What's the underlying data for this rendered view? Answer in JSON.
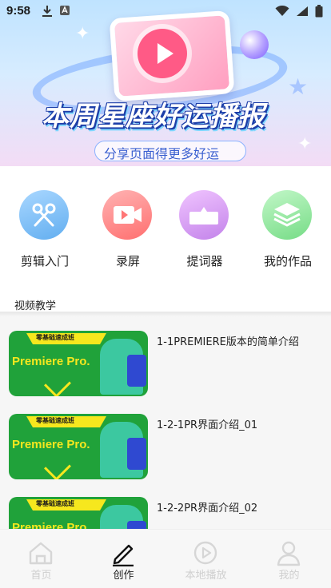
{
  "status_bar": {
    "time": "9:58"
  },
  "banner": {
    "title": "本周星座好运播报",
    "subtitle": "分享页面得更多好运"
  },
  "actions": [
    {
      "label": "剪辑入门",
      "icon": "scissors-icon",
      "color": "#79bff5"
    },
    {
      "label": "录屏",
      "icon": "video-camera-icon",
      "color": "#ff8686"
    },
    {
      "label": "提词器",
      "icon": "teleprompter-icon",
      "color": "#d79af0"
    },
    {
      "label": "我的作品",
      "icon": "layers-icon",
      "color": "#8ee79a"
    }
  ],
  "section": {
    "title": "视频教学"
  },
  "videos": [
    {
      "title": "1-1PREMIERE版本的简单介绍",
      "thumb_top": "零基础速成班",
      "thumb_main": "Premiere Pro."
    },
    {
      "title": "1-2-1PR界面介绍_01",
      "thumb_top": "零基础速成班",
      "thumb_main": "Premiere Pro."
    },
    {
      "title": "1-2-2PR界面介绍_02",
      "thumb_top": "零基础速成班",
      "thumb_main": "Premiere Pro."
    }
  ],
  "tabs": [
    {
      "label": "首页",
      "icon": "home-icon",
      "active": false
    },
    {
      "label": "创作",
      "icon": "pen-icon",
      "active": true
    },
    {
      "label": "本地播放",
      "icon": "play-circle-icon",
      "active": false
    },
    {
      "label": "我的",
      "icon": "user-icon",
      "active": false
    }
  ]
}
